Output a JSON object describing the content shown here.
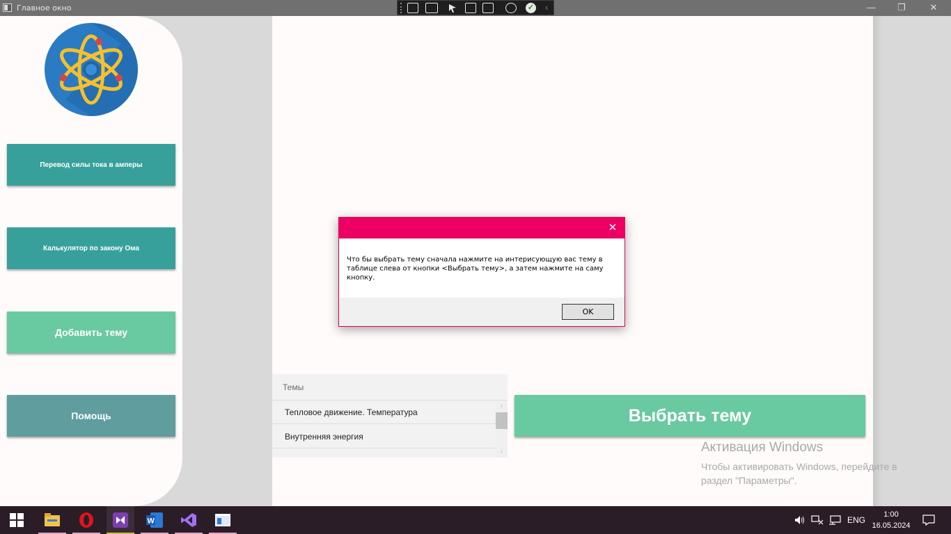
{
  "window": {
    "title": "Главное окно",
    "minimize_glyph": "—",
    "restore_glyph": "❐",
    "close_glyph": "✕"
  },
  "debug_toolbar": {
    "icons": [
      "select-element-icon",
      "record-icon",
      "pointer-select-icon",
      "display-layout-icon",
      "track-focus-icon",
      "hot-reload-icon",
      "check-icon",
      "collapse-icon"
    ],
    "check_glyph": "✓",
    "collapse_glyph": "‹"
  },
  "sidebar": {
    "logo_icon": "atom-icon",
    "buttons": [
      {
        "label": "Перевод силы тока в амперы"
      },
      {
        "label": "Калькулятор по закону Ома"
      },
      {
        "label": "Добавить тему"
      },
      {
        "label": "Помощь"
      }
    ]
  },
  "topics": {
    "header": "Темы",
    "rows": [
      {
        "label": "Тепловое движение. Температура"
      },
      {
        "label": "Внутренняя энергия"
      }
    ],
    "scroll_up_glyph": "↑",
    "scroll_down_glyph": "↓"
  },
  "choose_button": {
    "label": "Выбрать тему"
  },
  "watermark": {
    "title": "Активация Windows",
    "subtitle": "Чтобы активировать Windows, перейдите в раздел \"Параметры\"."
  },
  "dialog": {
    "message": "Что бы выбрать тему сначала нажмите на интерисующую вас тему в таблице слева от кнопки <Выбрать тему>, а затем нажмите на саму кнопку.",
    "ok_label": "OK",
    "close_glyph": "✕"
  },
  "taskbar": {
    "apps": [
      "windows-start-icon",
      "file-explorer-icon",
      "opera-icon",
      "visual-studio-app-icon",
      "word-icon",
      "visual-studio-icon",
      "app-window-icon"
    ],
    "language": "ENG",
    "time": "1:00",
    "date": "16.05.2024"
  },
  "colors": {
    "accent_pink": "#ed0063",
    "teal_button": "#38a09a",
    "mint_button": "#69c9a0",
    "help_button": "#5f9d9f"
  }
}
